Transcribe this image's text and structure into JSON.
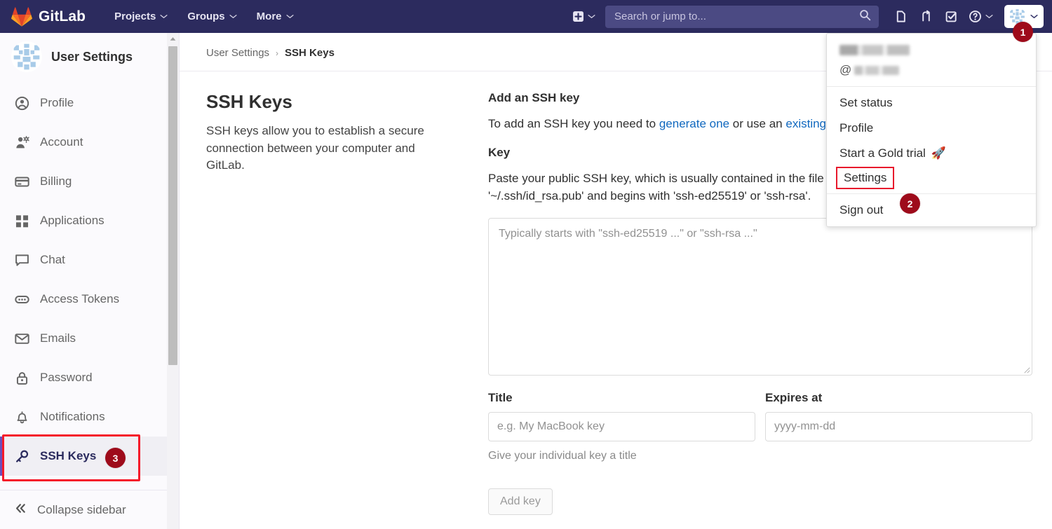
{
  "navbar": {
    "brand": "GitLab",
    "logo_icon": "gitlab-fox-logo",
    "links": [
      {
        "label": "Projects",
        "icon": "chevron-down-icon"
      },
      {
        "label": "Groups",
        "icon": "chevron-down-icon"
      },
      {
        "label": "More",
        "icon": "chevron-down-icon"
      }
    ],
    "create_new_icon": "plus-square-icon",
    "search": {
      "placeholder": "Search or jump to...",
      "value": "",
      "icon": "search-icon"
    },
    "icons": [
      {
        "name": "issues-icon"
      },
      {
        "name": "merge-requests-icon"
      },
      {
        "name": "todos-icon"
      },
      {
        "name": "help-icon"
      }
    ],
    "avatar_icon": "user-avatar-identicon",
    "avatar_chevron_icon": "chevron-down-icon",
    "colors": {
      "navbar_bg": "#2c2b5e",
      "search_bg": "#4b4a83"
    }
  },
  "sidebar": {
    "title": "User Settings",
    "avatar_icon": "user-avatar-identicon",
    "items": [
      {
        "label": "Profile",
        "icon": "user-circle-icon",
        "active": false
      },
      {
        "label": "Account",
        "icon": "account-gear-icon",
        "active": false
      },
      {
        "label": "Billing",
        "icon": "credit-card-icon",
        "active": false
      },
      {
        "label": "Applications",
        "icon": "grid-apps-icon",
        "active": false
      },
      {
        "label": "Chat",
        "icon": "chat-bubble-icon",
        "active": false
      },
      {
        "label": "Access Tokens",
        "icon": "token-pill-icon",
        "active": false
      },
      {
        "label": "Emails",
        "icon": "envelope-icon",
        "active": false
      },
      {
        "label": "Password",
        "icon": "lock-icon",
        "active": false
      },
      {
        "label": "Notifications",
        "icon": "bell-icon",
        "active": false
      },
      {
        "label": "SSH Keys",
        "icon": "key-icon",
        "active": true
      }
    ],
    "collapse": {
      "label": "Collapse sidebar",
      "icon": "double-chevron-left-icon"
    },
    "active_accent_color": "#6b4fbb"
  },
  "breadcrumb": {
    "parent": "User Settings",
    "separator": "›",
    "current": "SSH Keys"
  },
  "main": {
    "left": {
      "heading": "SSH Keys",
      "description": "SSH keys allow you to establish a secure connection between your computer and GitLab."
    },
    "form": {
      "heading": "Add an SSH key",
      "intro_prefix": "To add an SSH key you need to ",
      "intro_link1": "generate one",
      "intro_middle": " or use an ",
      "intro_link2": "existing key",
      "intro_suffix": ".",
      "key_label": "Key",
      "key_help_line1": "Paste your public SSH key, which is usually contained in the file",
      "key_help_line2": "'~/.ssh/id_rsa.pub' and begins with 'ssh-ed25519' or 'ssh-rsa'.",
      "key_placeholder": "Typically starts with \"ssh-ed25519 ...\" or \"ssh-rsa ...\"",
      "key_value": "",
      "title_label": "Title",
      "title_placeholder": "e.g. My MacBook key",
      "title_value": "",
      "title_help": "Give your individual key a title",
      "expires_label": "Expires at",
      "expires_placeholder": "yyyy-mm-dd",
      "expires_value": "",
      "submit_label": "Add key",
      "link_color": "#1068bf"
    }
  },
  "user_menu": {
    "name_redacted": "",
    "at_sign": "@",
    "username_redacted": "",
    "items": [
      {
        "label": "Set status",
        "emoji": ""
      },
      {
        "label": "Profile",
        "emoji": ""
      },
      {
        "label": "Start a Gold trial",
        "emoji": "🚀"
      },
      {
        "label": "Settings",
        "emoji": "",
        "highlighted": true
      }
    ],
    "sign_out": "Sign out"
  },
  "annotations": {
    "badge1": "1",
    "badge2": "2",
    "badge3": "3",
    "badge_color": "#9e0b1b",
    "box_color": "#f51a2a"
  }
}
